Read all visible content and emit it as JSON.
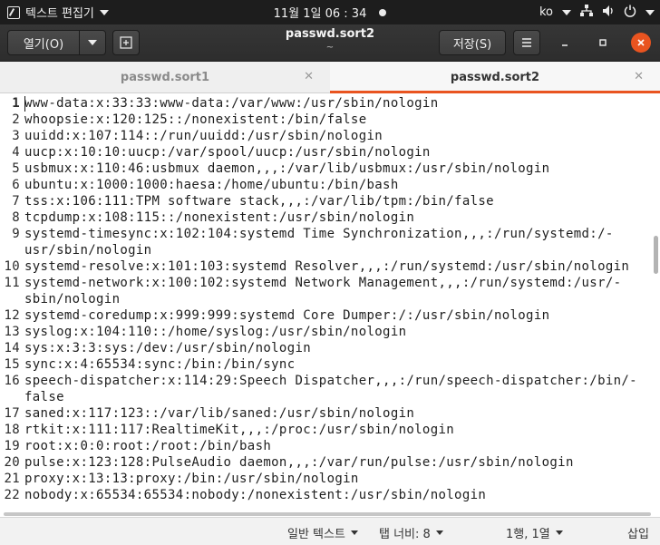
{
  "top_panel": {
    "app_name": "텍스트 편집기",
    "clock": "11월 1일  06 : 34",
    "input_method": "ko"
  },
  "header": {
    "open_label": "열기(O)",
    "title": "passwd.sort2",
    "subtitle": "~",
    "save_label": "저장(S)"
  },
  "tabs": [
    {
      "label": "passwd.sort1",
      "active": false
    },
    {
      "label": "passwd.sort2",
      "active": true
    }
  ],
  "editor": {
    "lines": [
      {
        "n": "1",
        "text": "www-data:x:33:33:www-data:/var/www:/usr/sbin/nologin"
      },
      {
        "n": "2",
        "text": "whoopsie:x:120:125::/nonexistent:/bin/false"
      },
      {
        "n": "3",
        "text": "uuidd:x:107:114::/run/uuidd:/usr/sbin/nologin"
      },
      {
        "n": "4",
        "text": "uucp:x:10:10:uucp:/var/spool/uucp:/usr/sbin/nologin"
      },
      {
        "n": "5",
        "text": "usbmux:x:110:46:usbmux daemon,,,:/var/lib/usbmux:/usr/sbin/nologin"
      },
      {
        "n": "6",
        "text": "ubuntu:x:1000:1000:haesa:/home/ubuntu:/bin/bash"
      },
      {
        "n": "7",
        "text": "tss:x:106:111:TPM software stack,,,:/var/lib/tpm:/bin/false"
      },
      {
        "n": "8",
        "text": "tcpdump:x:108:115::/nonexistent:/usr/sbin/nologin"
      },
      {
        "n": "9",
        "text": "systemd-timesync:x:102:104:systemd Time Synchronization,,,:/run/systemd:/-"
      },
      {
        "n": "",
        "text": "usr/sbin/nologin"
      },
      {
        "n": "10",
        "text": "systemd-resolve:x:101:103:systemd Resolver,,,:/run/systemd:/usr/sbin/nologin"
      },
      {
        "n": "11",
        "text": "systemd-network:x:100:102:systemd Network Management,,,:/run/systemd:/usr/-"
      },
      {
        "n": "",
        "text": "sbin/nologin"
      },
      {
        "n": "12",
        "text": "systemd-coredump:x:999:999:systemd Core Dumper:/:/usr/sbin/nologin"
      },
      {
        "n": "13",
        "text": "syslog:x:104:110::/home/syslog:/usr/sbin/nologin"
      },
      {
        "n": "14",
        "text": "sys:x:3:3:sys:/dev:/usr/sbin/nologin"
      },
      {
        "n": "15",
        "text": "sync:x:4:65534:sync:/bin:/bin/sync"
      },
      {
        "n": "16",
        "text": "speech-dispatcher:x:114:29:Speech Dispatcher,,,:/run/speech-dispatcher:/bin/-"
      },
      {
        "n": "",
        "text": "false"
      },
      {
        "n": "17",
        "text": "saned:x:117:123::/var/lib/saned:/usr/sbin/nologin"
      },
      {
        "n": "18",
        "text": "rtkit:x:111:117:RealtimeKit,,,:/proc:/usr/sbin/nologin"
      },
      {
        "n": "19",
        "text": "root:x:0:0:root:/root:/bin/bash"
      },
      {
        "n": "20",
        "text": "pulse:x:123:128:PulseAudio daemon,,,:/var/run/pulse:/usr/sbin/nologin"
      },
      {
        "n": "21",
        "text": "proxy:x:13:13:proxy:/bin:/usr/sbin/nologin"
      },
      {
        "n": "22",
        "text": "nobody:x:65534:65534:nobody:/nonexistent:/usr/sbin/nologin"
      }
    ]
  },
  "status_bar": {
    "language": "일반 텍스트",
    "tab_width": "탭 너비: 8",
    "position": "1행, 1열",
    "mode": "삽입"
  },
  "colors": {
    "accent": "#e95420",
    "panel": "#1d1d1d",
    "headerbar": "#333333"
  }
}
